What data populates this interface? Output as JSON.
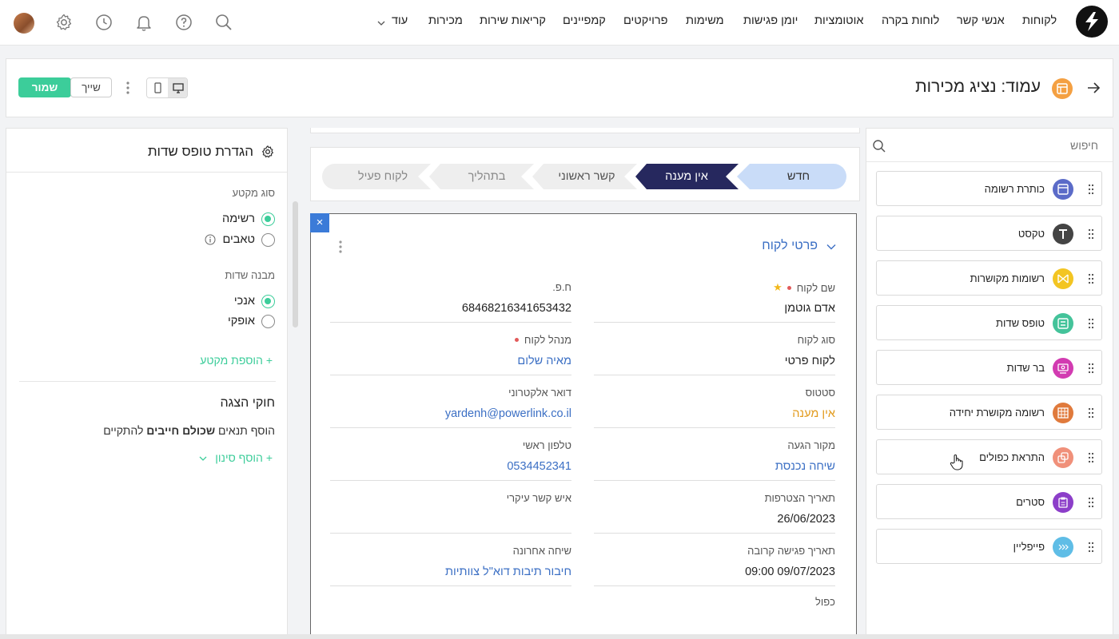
{
  "topnav": {
    "items": [
      "לקוחות",
      "אנשי קשר",
      "לוחות בקרה",
      "אוטומציות",
      "יומן פגישות",
      "משימות",
      "פרויקטים",
      "קמפיינים",
      "קריאות שירות",
      "מכירות",
      "עוד"
    ]
  },
  "header": {
    "title": "עמוד: נציג מכירות",
    "save_label": "שמור",
    "assign_label": "שייך"
  },
  "left_panel": {
    "title": "הגדרת טופס שדות",
    "section_type_label": "סוג מקטע",
    "section_type_options": [
      "רשימה",
      "טאבים"
    ],
    "section_type_selected": "רשימה",
    "structure_label": "מבנה שדות",
    "structure_options": [
      "אנכי",
      "אופקי"
    ],
    "structure_selected": "אנכי",
    "add_section": "+ הוספת מקטע",
    "display_rules_title": "חוקי הצגה",
    "display_rules_desc_pre": "הוסף תנאים ",
    "display_rules_desc_bold": "שכולם חייבים",
    "display_rules_desc_post": " להתקיים",
    "add_filter": "+ הוסף סינון"
  },
  "pipeline": {
    "stages": [
      "חדש",
      "אין מענה",
      "קשר ראשוני",
      "בתהליך",
      "לקוח פעיל"
    ],
    "active_index": 1,
    "colors": {
      "done": "#c9dcf8",
      "active": "#26285e",
      "pending": "#eeeeee"
    }
  },
  "details": {
    "title": "פרטי לקוח",
    "close": "×",
    "fields_right": [
      {
        "label": "שם לקוח",
        "value": "אדם גוטמן",
        "required": true,
        "star": true
      },
      {
        "label": "סוג לקוח",
        "value": "לקוח פרטי"
      },
      {
        "label": "סטטוס",
        "value": "אין מענה",
        "style": "orange"
      },
      {
        "label": "מקור הגעה",
        "value": "שיחה נכנסת",
        "style": "link"
      },
      {
        "label": "תאריך הצטרפות",
        "value": "26/06/2023"
      },
      {
        "label": "תאריך פגישה קרובה",
        "value": "09/07/2023 09:00"
      },
      {
        "label": "כפול",
        "value": ""
      }
    ],
    "fields_left": [
      {
        "label": "ח.פ.",
        "value": "68468216341653432"
      },
      {
        "label": "מנהל לקוח",
        "value": "מאיה שלום",
        "required": true,
        "style": "link"
      },
      {
        "label": "דואר אלקטרוני",
        "value": "yardenh@powerlink.co.il",
        "style": "link"
      },
      {
        "label": "טלפון ראשי",
        "value": "0534452341",
        "style": "link"
      },
      {
        "label": "איש קשר עיקרי",
        "value": ""
      },
      {
        "label": "שיחה אחרונה",
        "value": "חיבור תיבות דוא\"ל צוותיות",
        "style": "link"
      }
    ]
  },
  "right_panel": {
    "search_placeholder": "חיפוש",
    "components": [
      {
        "label": "כותרת רשומה",
        "icon": "record-title-icon",
        "color": "#5b6bc8"
      },
      {
        "label": "טקסט",
        "icon": "text-icon",
        "color": "#444444"
      },
      {
        "label": "רשומות מקושרות",
        "icon": "linked-records-icon",
        "color": "#f3c522"
      },
      {
        "label": "טופס שדות",
        "icon": "fields-form-icon",
        "color": "#44c39a"
      },
      {
        "label": "בר שדות",
        "icon": "fields-bar-icon",
        "color": "#d23bb1"
      },
      {
        "label": "רשומה מקושרת יחידה",
        "icon": "single-linked-record-icon",
        "color": "#e07a3c"
      },
      {
        "label": "התראת כפולים",
        "icon": "duplicates-alert-icon",
        "color": "#f0907a"
      },
      {
        "label": "סטרים",
        "icon": "stream-icon",
        "color": "#8c3ec9"
      },
      {
        "label": "פייפליין",
        "icon": "pipeline-icon",
        "color": "#5fbde6"
      }
    ]
  }
}
